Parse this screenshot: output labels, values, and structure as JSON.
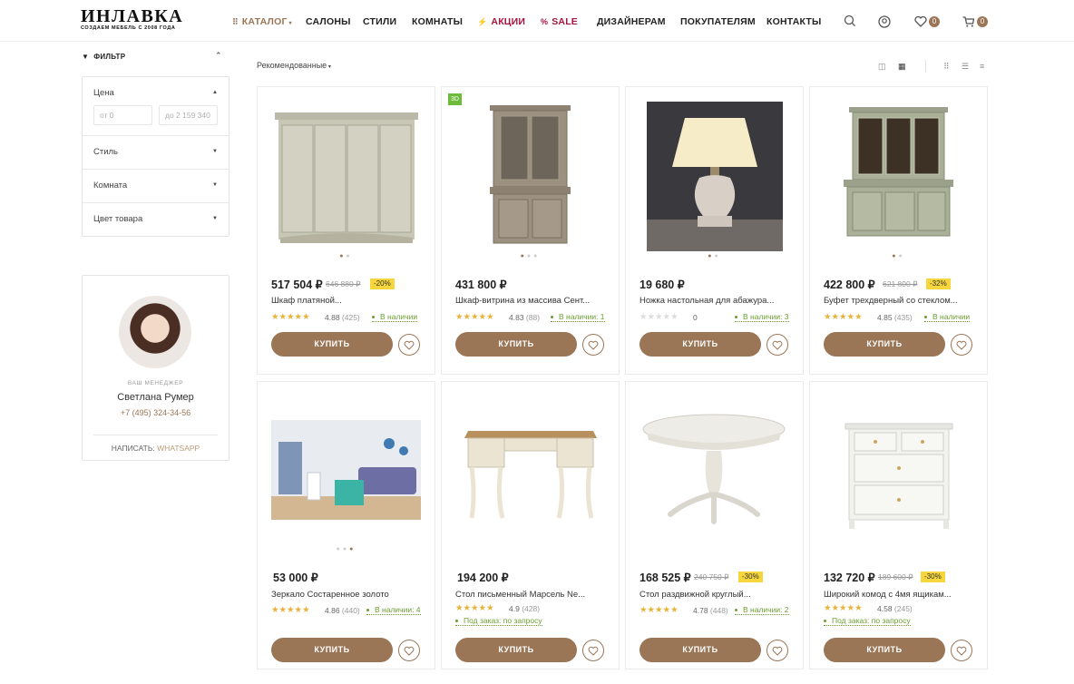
{
  "header": {
    "logo_title": "ИНЛАВКА",
    "logo_subtitle": "СОЗДАЕМ МЕБЕЛЬ С 2008 ГОДА",
    "nav": [
      "КАТАЛОГ",
      "САЛОНЫ",
      "СТИЛИ",
      "КОМНАТЫ",
      "АКЦИИ",
      "SALE",
      "ДИЗАЙНЕРАМ",
      "ПОКУПАТЕЛЯМ",
      "КОНТАКТЫ"
    ],
    "favorites_count": "0",
    "cart_count": "0"
  },
  "sidebar": {
    "filter_title": "ФИЛЬТР",
    "price_label": "Цена",
    "price_from_placeholder": "от 0",
    "price_to_placeholder": "до 2 159 340",
    "style_label": "Стиль",
    "room_label": "Комната",
    "color_label": "Цвет товара"
  },
  "manager": {
    "role": "ВАШ МЕНЕДЖЕР",
    "name": "Светлана Румер",
    "phone": "+7 (495) 324-34-56",
    "write_prefix": "НАПИСАТЬ:",
    "write_channel": "WHATSAPP"
  },
  "sort": {
    "label": "Рекомендованные"
  },
  "buttons": {
    "buy": "КУПИТЬ"
  },
  "colors": {
    "accent": "#9a7656",
    "promo": "#a4133f",
    "discount_bg": "#f6d63c",
    "stock": "#6d9f32"
  },
  "products": [
    {
      "price": "517 504 ₽",
      "old_price": "646 880 ₽",
      "discount": "-20%",
      "name": "Шкаф платяной...",
      "rating": "4.88",
      "reviews": "(425)",
      "stock": "В наличии",
      "order": ""
    },
    {
      "price": "431 800 ₽",
      "old_price": "",
      "discount": "",
      "name": "Шкаф-витрина из массива Сент...",
      "rating": "4.83",
      "reviews": "(88)",
      "stock": "В наличии: 1",
      "order": "",
      "badge": "3D"
    },
    {
      "price": "19 680 ₽",
      "old_price": "",
      "discount": "",
      "name": "Ножка настольная для абажура...",
      "rating": "0",
      "reviews": "",
      "stock": "В наличии: 3",
      "order": ""
    },
    {
      "price": "422 800 ₽",
      "old_price": "621 800 ₽",
      "discount": "-32%",
      "name": "Буфет трехдверный со стеклом...",
      "rating": "4.85",
      "reviews": "(435)",
      "stock": "В наличии",
      "order": ""
    },
    {
      "price": "53 000 ₽",
      "old_price": "",
      "discount": "",
      "name": "Зеркало Состаренное золото",
      "rating": "4.86",
      "reviews": "(440)",
      "stock": "В наличии: 4",
      "order": ""
    },
    {
      "price": "194 200 ₽",
      "old_price": "",
      "discount": "",
      "name": "Стол письменный Марсель Ne...",
      "rating": "4.9",
      "reviews": "(428)",
      "stock": "",
      "order": "Под заказ: по запросу"
    },
    {
      "price": "168 525 ₽",
      "old_price": "240 750 ₽",
      "discount": "-30%",
      "name": "Стол раздвижной круглый...",
      "rating": "4.78",
      "reviews": "(448)",
      "stock": "В наличии: 2",
      "order": ""
    },
    {
      "price": "132 720 ₽",
      "old_price": "189 600 ₽",
      "discount": "-30%",
      "name": "Широкий комод с 4мя ящикам...",
      "rating": "4.58",
      "reviews": "(245)",
      "stock": "",
      "order": "Под заказ: по запросу"
    }
  ]
}
